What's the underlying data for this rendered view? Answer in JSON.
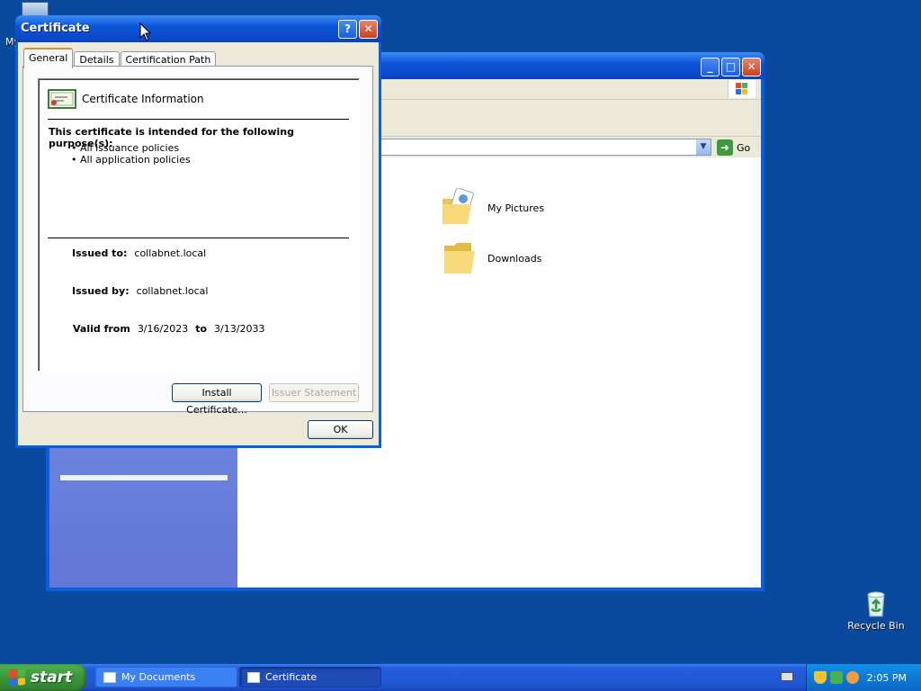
{
  "desktop": {
    "my_computer_label": "My Computer",
    "recycle_bin_label": "Recycle Bin"
  },
  "explorer": {
    "title": "My Documents",
    "go_label": "Go",
    "items": [
      {
        "name": "My Pictures",
        "icon": "pictures-folder-icon"
      },
      {
        "name": "Downloads",
        "icon": "folder-icon"
      }
    ]
  },
  "certificate": {
    "title": "Certificate",
    "tabs": [
      "General",
      "Details",
      "Certification Path"
    ],
    "active_tab": "General",
    "info_heading": "Certificate Information",
    "purpose_title": "This certificate is intended for the following purpose(s):",
    "purposes": [
      "All issuance policies",
      "All application policies"
    ],
    "issued_to_label": "Issued to:",
    "issued_to_value": "collabnet.local",
    "issued_by_label": "Issued by:",
    "issued_by_value": "collabnet.local",
    "valid_from_label": "Valid from",
    "valid_from_value": "3/16/2023",
    "valid_to_label": "to",
    "valid_to_value": "3/13/2033",
    "install_button": "Install Certificate...",
    "issuer_button": "Issuer Statement",
    "ok_button": "OK",
    "help_button": "?",
    "close_button": "✕"
  },
  "taskbar": {
    "start_label": "start",
    "tasks": [
      {
        "label": "My Documents",
        "active": false
      },
      {
        "label": "Certificate",
        "active": true
      }
    ],
    "clock": "2:05 PM"
  },
  "colors": {
    "desktop": "#0a4a9e",
    "title_bar": "#0d56d9",
    "start_green": "#3a963a",
    "tray_blue": "#0e7ad6"
  }
}
